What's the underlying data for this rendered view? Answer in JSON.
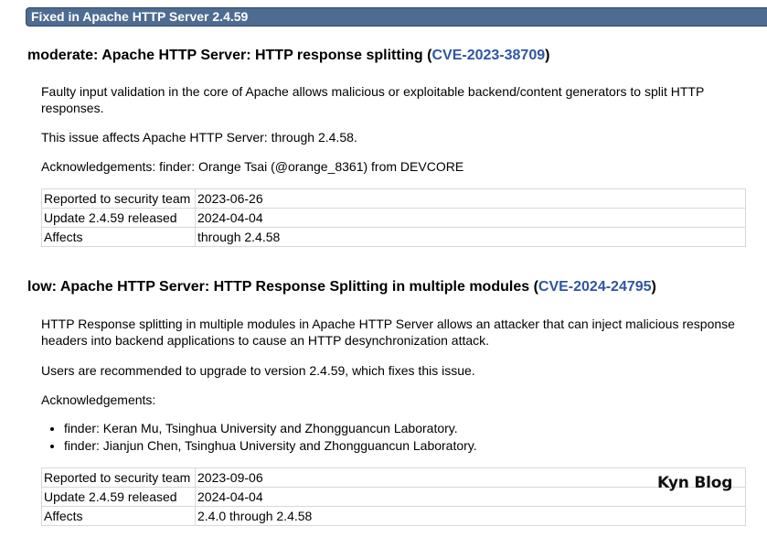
{
  "section_header": "Fixed in Apache HTTP Server 2.4.59",
  "vulns": [
    {
      "title_prefix": "moderate: Apache HTTP Server: HTTP response splitting (",
      "cve": "CVE-2023-38709",
      "title_suffix": ")",
      "paragraphs": [
        "Faulty input validation in the core of Apache allows malicious or exploitable backend/content generators to split HTTP responses.",
        "This issue affects Apache HTTP Server: through 2.4.58.",
        "Acknowledgements: finder: Orange Tsai (@orange_8361) from DEVCORE"
      ],
      "table": [
        {
          "label": "Reported to security team",
          "value": "2023-06-26"
        },
        {
          "label": "Update 2.4.59 released",
          "value": "2024-04-04"
        },
        {
          "label": "Affects",
          "value": "through 2.4.58"
        }
      ]
    },
    {
      "title_prefix": "low: Apache HTTP Server: HTTP Response Splitting in multiple modules (",
      "cve": "CVE-2024-24795",
      "title_suffix": ")",
      "paragraphs": [
        "HTTP Response splitting in multiple modules in Apache HTTP Server allows an attacker that can inject malicious response headers into backend applications to cause an HTTP desynchronization attack.",
        "Users are recommended to upgrade to version 2.4.59, which fixes this issue.",
        "Acknowledgements:"
      ],
      "bullets": [
        "finder: Keran Mu, Tsinghua University and Zhongguancun Laboratory.",
        "finder: Jianjun Chen, Tsinghua University and Zhongguancun Laboratory."
      ],
      "table": [
        {
          "label": "Reported to security team",
          "value": "2023-09-06"
        },
        {
          "label": "Update 2.4.59 released",
          "value": "2024-04-04"
        },
        {
          "label": "Affects",
          "value": "2.4.0 through 2.4.58"
        }
      ]
    }
  ],
  "watermark": "Kyn Blog",
  "colors": {
    "header_bg": "#4e6c91",
    "link": "#2e55a6"
  }
}
